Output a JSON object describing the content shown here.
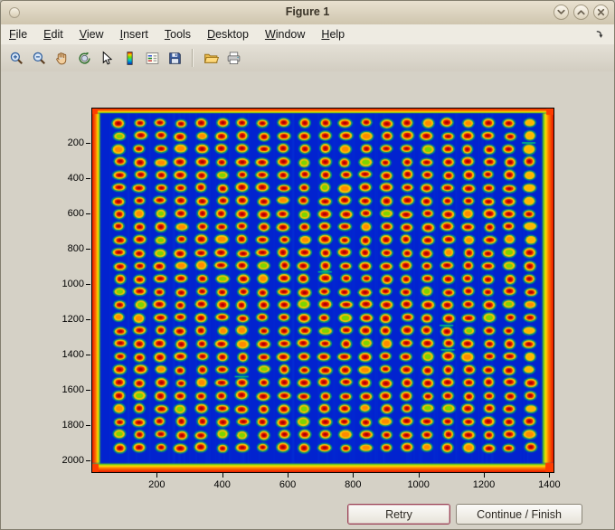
{
  "window": {
    "title": "Figure 1",
    "controls": [
      {
        "icon": "chevron-down-icon"
      },
      {
        "icon": "chevron-up-icon"
      },
      {
        "icon": "close-icon"
      }
    ]
  },
  "menu": {
    "items": [
      {
        "initial": "F",
        "rest": "ile"
      },
      {
        "initial": "E",
        "rest": "dit"
      },
      {
        "initial": "V",
        "rest": "iew"
      },
      {
        "initial": "I",
        "rest": "nsert"
      },
      {
        "initial": "T",
        "rest": "ools"
      },
      {
        "initial": "D",
        "rest": "esktop"
      },
      {
        "initial": "W",
        "rest": "indow"
      },
      {
        "initial": "H",
        "rest": "elp"
      }
    ],
    "overflow_icon": "dock-arrow-icon"
  },
  "toolbar": {
    "buttons": [
      {
        "icon": "zoom-in-icon"
      },
      {
        "icon": "zoom-out-icon"
      },
      {
        "icon": "pan-hand-icon"
      },
      {
        "icon": "rotate-3d-icon"
      },
      {
        "icon": "data-cursor-icon"
      },
      {
        "icon": "insert-colorbar-icon"
      },
      {
        "icon": "insert-legend-icon"
      },
      {
        "icon": "save-icon"
      },
      {
        "icon": "open-folder-icon"
      },
      {
        "icon": "print-icon"
      }
    ]
  },
  "figure": {
    "background": "#d5d1c6",
    "axes": {
      "x_ticks": [
        200,
        400,
        600,
        800,
        1000,
        1200,
        1400
      ],
      "y_ticks": [
        200,
        400,
        600,
        800,
        1000,
        1200,
        1400,
        1600,
        1800,
        2000
      ],
      "x_max": 1410,
      "y_max": 2060
    },
    "image": {
      "rows": 26,
      "cols": 21,
      "seed": 42,
      "bg": "#0223cf",
      "halo": "#00a868",
      "ring": "#ffc400",
      "center": "#e81600",
      "core": "#a80000"
    }
  },
  "buttons": {
    "retry": "Retry",
    "continue": "Continue / Finish"
  },
  "chart_data": {
    "type": "heatmap",
    "title": "",
    "xlabel": "",
    "ylabel": "",
    "colormap": "jet",
    "x_range": [
      0,
      1410
    ],
    "y_range": [
      0,
      2060
    ],
    "x_ticks": [
      200,
      400,
      600,
      800,
      1000,
      1200,
      1400
    ],
    "y_ticks": [
      200,
      400,
      600,
      800,
      1000,
      1200,
      1400,
      1600,
      1800,
      2000
    ],
    "grid_rows": 26,
    "grid_cols": 21,
    "description": "Microarray plate scan displayed with jet colormap: deep blue background, ~21x26 grid of spots with red centers, yellow/orange rings and green halos; hot red/orange/yellow saturation bands along all four image edges, strongest on right and bottom."
  }
}
